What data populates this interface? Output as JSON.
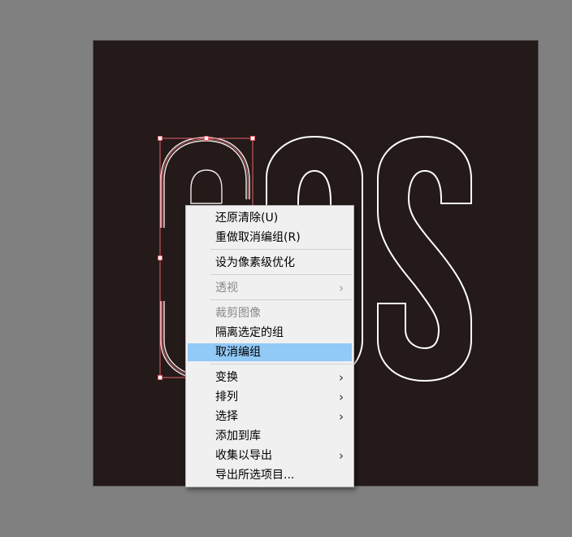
{
  "canvas": {
    "background": "#808080",
    "artboard_color": "#231a19",
    "art_text": "SOS",
    "outline_color": "#ffffff",
    "selection_color": "#e8636b"
  },
  "context_menu": {
    "highlight_color": "#91c9f7",
    "submenu_arrow": "›",
    "items": [
      {
        "label": "还原清除(U)",
        "enabled": true
      },
      {
        "label": "重做取消编组(R)",
        "enabled": true
      },
      {
        "label": "设为像素级优化",
        "enabled": true
      },
      {
        "label": "透视",
        "enabled": false,
        "submenu": true
      },
      {
        "label": "裁剪图像",
        "enabled": false
      },
      {
        "label": "隔离选定的组",
        "enabled": true
      },
      {
        "label": "取消编组",
        "enabled": true,
        "highlighted": true
      },
      {
        "label": "变换",
        "enabled": true,
        "submenu": true
      },
      {
        "label": "排列",
        "enabled": true,
        "submenu": true
      },
      {
        "label": "选择",
        "enabled": true,
        "submenu": true
      },
      {
        "label": "添加到库",
        "enabled": true
      },
      {
        "label": "收集以导出",
        "enabled": true,
        "submenu": true
      },
      {
        "label": "导出所选项目...",
        "enabled": true
      }
    ]
  }
}
